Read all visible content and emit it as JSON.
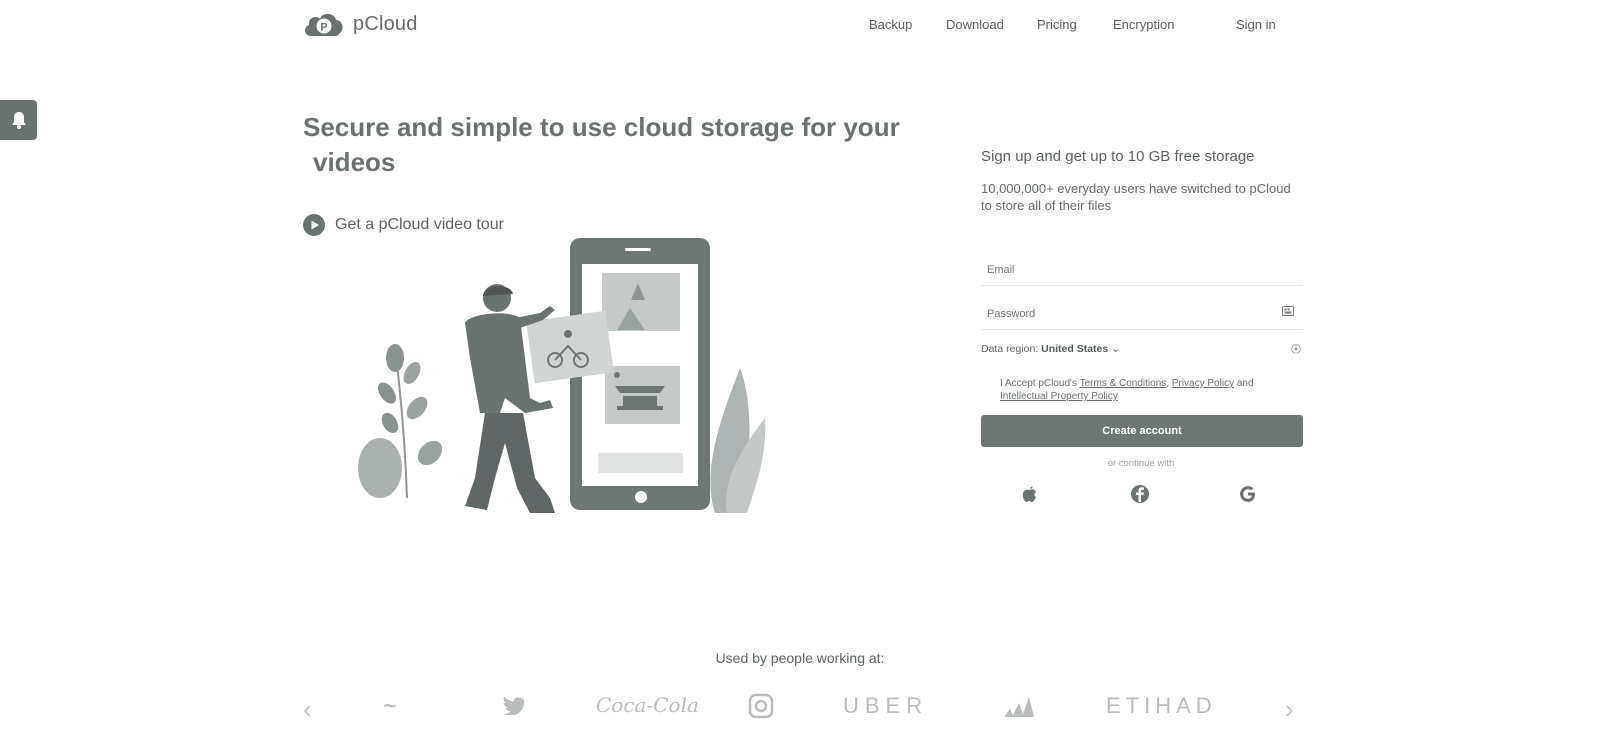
{
  "header": {
    "brand": "pCloud",
    "nav": [
      {
        "label": "Backup"
      },
      {
        "label": "Download"
      },
      {
        "label": "Pricing"
      },
      {
        "label": "Encryption"
      },
      {
        "label": "Sign in"
      }
    ]
  },
  "hero": {
    "title_line1": "Secure and simple to use cloud storage for your",
    "title_line2": "videos",
    "tour_label": "Get a pCloud video tour"
  },
  "signup": {
    "title": "Sign up and get up to 10 GB free storage",
    "subtitle": "10,000,000+ everyday users have switched to pCloud to store all of their files",
    "email_placeholder": "Email",
    "password_placeholder": "Password",
    "region_label": "Data region:",
    "region_value": "United States",
    "terms_prefix": "I Accept pCloud's",
    "terms_link": "Terms & Conditions",
    "privacy_link": "Privacy Policy",
    "and_text": "and",
    "ip_link": "Intellectual Property Policy",
    "create_button": "Create account",
    "continue_text": "or continue with"
  },
  "companies": {
    "heading": "Used by people working at:",
    "logos": [
      "nike",
      "twitter",
      "Coca-Cola",
      "instagram",
      "UBER",
      "adidas",
      "ETIHAD"
    ]
  },
  "colors": {
    "primary_gray": "#6e7674",
    "background": "#ffffff"
  }
}
